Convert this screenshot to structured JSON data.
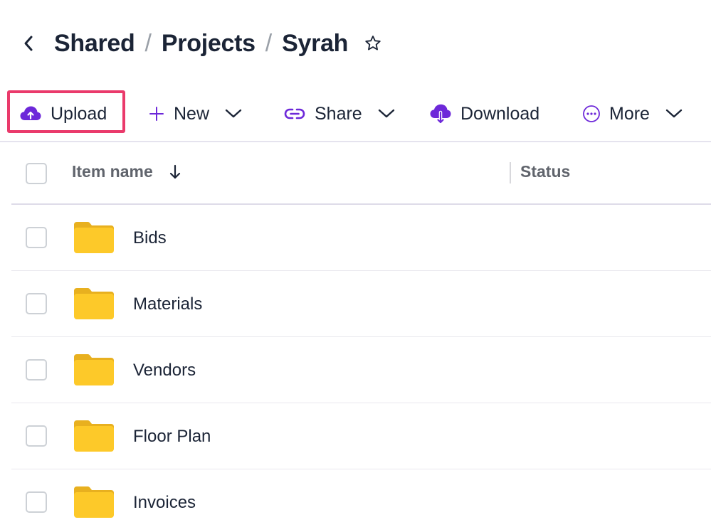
{
  "breadcrumb": {
    "items": [
      "Shared",
      "Projects",
      "Syrah"
    ],
    "separator": "/"
  },
  "toolbar": {
    "upload_label": "Upload",
    "new_label": "New",
    "share_label": "Share",
    "download_label": "Download",
    "more_label": "More"
  },
  "table": {
    "columns": {
      "name": "Item name",
      "status": "Status"
    },
    "rows": [
      {
        "name": "Bids",
        "type": "folder"
      },
      {
        "name": "Materials",
        "type": "folder"
      },
      {
        "name": "Vendors",
        "type": "folder"
      },
      {
        "name": "Floor Plan",
        "type": "folder"
      },
      {
        "name": "Invoices",
        "type": "folder"
      }
    ]
  },
  "colors": {
    "accent": "#6d28d9",
    "highlight": "#ea3a6b",
    "folder": "#fdc929",
    "folder_tab": "#e8b01f",
    "text": "#1b2436"
  }
}
